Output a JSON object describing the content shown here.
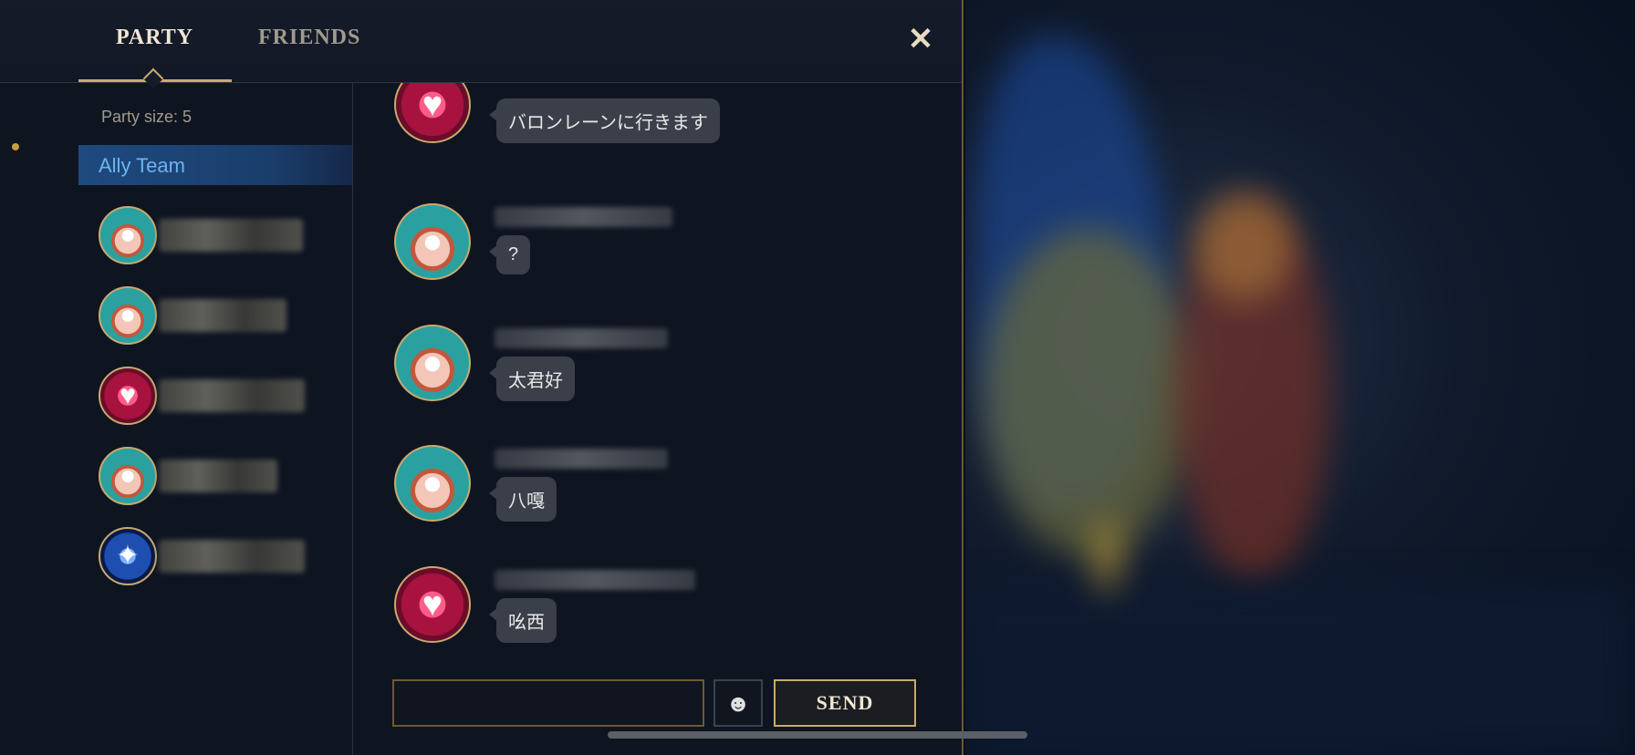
{
  "tabs": [
    {
      "label": "PARTY",
      "active": true
    },
    {
      "label": "FRIENDS",
      "active": false
    }
  ],
  "close_icon": "✕",
  "sidebar": {
    "party_size": "Party size: 5",
    "team_label": "Ally Team",
    "members": [
      {
        "avatar": "poro-icon"
      },
      {
        "avatar": "poro-icon"
      },
      {
        "avatar": "heart-icon"
      },
      {
        "avatar": "poro-icon"
      },
      {
        "avatar": "blue-champion-icon"
      }
    ]
  },
  "messages": [
    {
      "avatar": "heart-icon",
      "text": "バロンレーンに行きます"
    },
    {
      "avatar": "poro-icon",
      "text": "?"
    },
    {
      "avatar": "poro-icon",
      "text": "太君好"
    },
    {
      "avatar": "poro-icon",
      "text": "八嘎"
    },
    {
      "avatar": "heart-icon",
      "text": "吆西"
    }
  ],
  "input": {
    "value": "",
    "placeholder": ""
  },
  "emoji_icon": "☻",
  "send_label": "SEND",
  "colors": {
    "gold_accent": "#c8aa6e",
    "panel_bg": "#0f1421",
    "ally_team_blue": "#1e4a7e",
    "bubble_bg": "#3a3f4a"
  }
}
